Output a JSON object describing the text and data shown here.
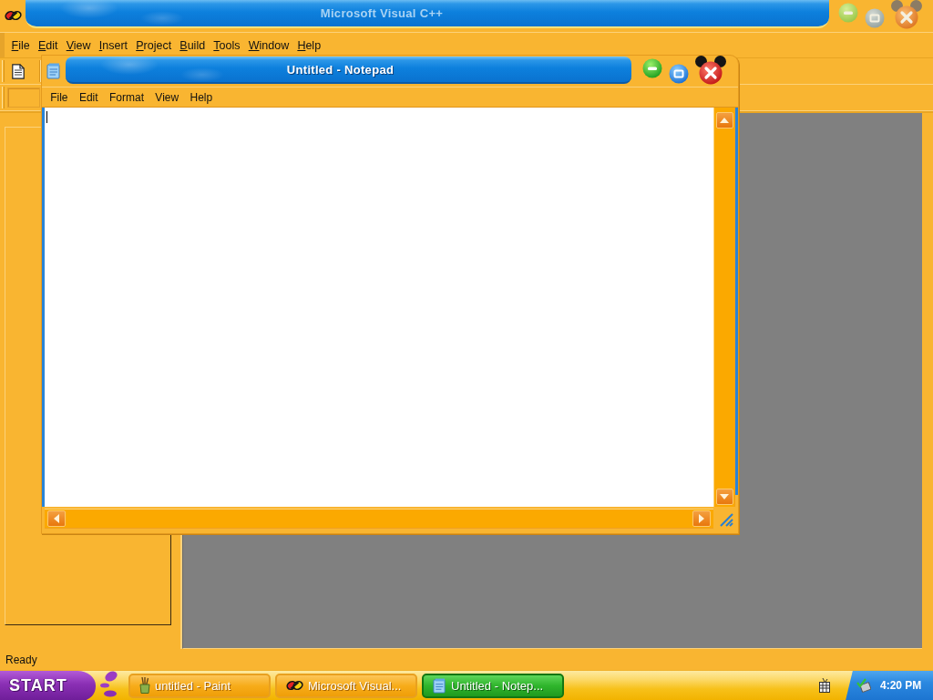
{
  "main_window": {
    "title": "Microsoft Visual C++",
    "active": false,
    "menu": {
      "accelerators_shown": true,
      "items": [
        "File",
        "Edit",
        "View",
        "Insert",
        "Project",
        "Build",
        "Tools",
        "Window",
        "Help"
      ]
    },
    "status_bar": "Ready"
  },
  "notepad": {
    "title": "Untitled - Notepad",
    "active": true,
    "menu": [
      "File",
      "Edit",
      "Format",
      "View",
      "Help"
    ]
  },
  "taskbar": {
    "start": "START",
    "buttons": [
      {
        "label": "untitled - Paint",
        "kind": "paint",
        "selected": false
      },
      {
        "label": "Microsoft Visual...",
        "kind": "ide",
        "selected": false
      },
      {
        "label": "Untitled - Notep...",
        "kind": "notepad",
        "selected": true
      }
    ],
    "clock": "4:20 PM"
  }
}
